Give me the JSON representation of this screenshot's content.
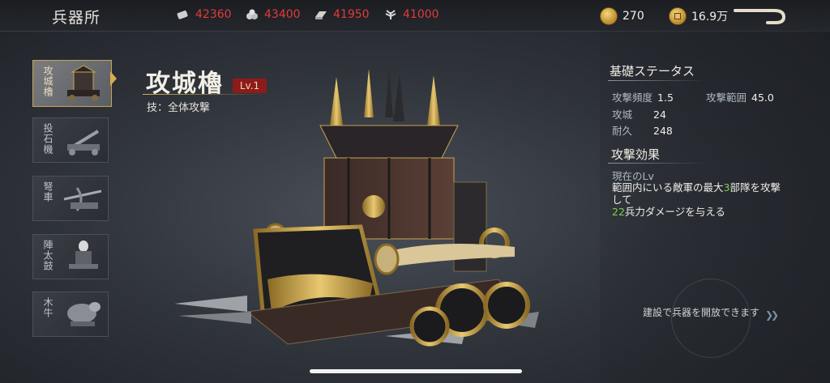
{
  "header": {
    "title": "兵器所",
    "resources": [
      {
        "icon": "wood-icon",
        "value": "42360"
      },
      {
        "icon": "stone-icon",
        "value": "43400"
      },
      {
        "icon": "iron-icon",
        "value": "41950"
      },
      {
        "icon": "grain-icon",
        "value": "41000"
      }
    ],
    "currencies": [
      {
        "icon": "gold-coin-icon",
        "value": "270"
      },
      {
        "icon": "copper-coin-icon",
        "value": "16.9万"
      }
    ]
  },
  "weapon_list": [
    {
      "label": "攻城櫓",
      "active": true
    },
    {
      "label": "投石機",
      "active": false
    },
    {
      "label": "弩車",
      "active": false
    },
    {
      "label": "陣太鼓",
      "active": false
    },
    {
      "label": "木牛",
      "active": false
    }
  ],
  "weapon": {
    "name": "攻城櫓",
    "level": "Lv.1",
    "skill": "技：全体攻撃"
  },
  "stats": {
    "title": "基礎ステータス",
    "attack_freq_label": "攻撃頻度",
    "attack_freq_value": "1.5",
    "attack_range_label": "攻撃範囲",
    "attack_range_value": "45.0",
    "siege_label": "攻城",
    "siege_value": "24",
    "durability_label": "耐久",
    "durability_value": "248"
  },
  "effect": {
    "title": "攻撃効果",
    "current_label": "現在のLv",
    "line1_a": "範囲内にいる敵軍の最大",
    "line1_num": "3",
    "line1_b": "部隊を攻撃",
    "line2": "して",
    "line3_num": "22",
    "line3_b": "兵力ダメージを与える"
  },
  "unlock_hint": "建設で兵器を開放できます",
  "colors": {
    "accent_gold": "#d7ad4e",
    "resource_red": "#e23b3b",
    "highlight_green": "#7ed24e",
    "level_badge": "#8e1b1b"
  }
}
